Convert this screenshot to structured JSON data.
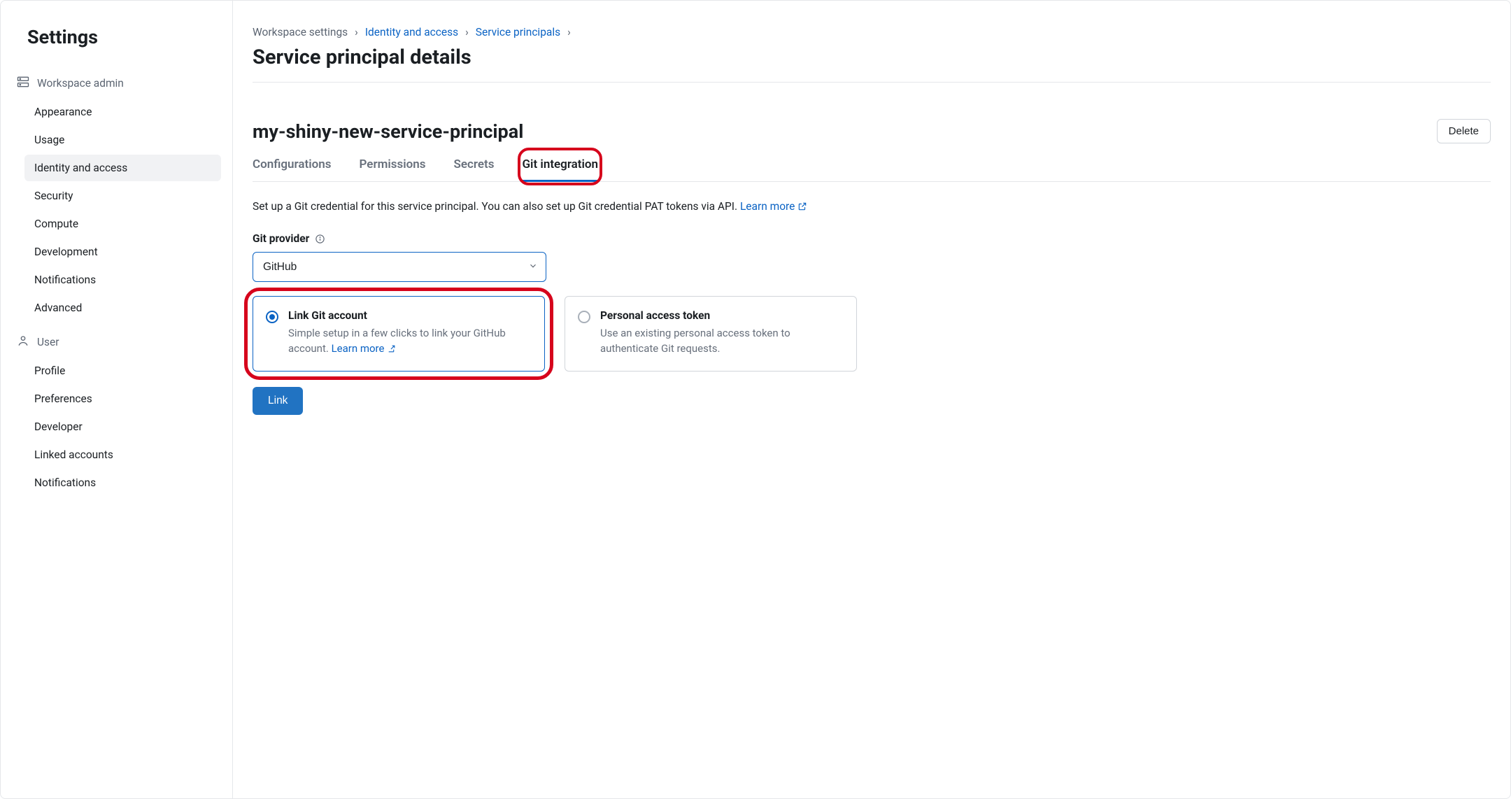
{
  "sidebar": {
    "title": "Settings",
    "sections": [
      {
        "label": "Workspace admin",
        "items": [
          "Appearance",
          "Usage",
          "Identity and access",
          "Security",
          "Compute",
          "Development",
          "Notifications",
          "Advanced"
        ]
      },
      {
        "label": "User",
        "items": [
          "Profile",
          "Preferences",
          "Developer",
          "Linked accounts",
          "Notifications"
        ]
      }
    ],
    "active_item": "Identity and access"
  },
  "breadcrumb": {
    "items": [
      "Workspace settings",
      "Identity and access",
      "Service principals"
    ]
  },
  "page": {
    "title": "Service principal details",
    "principal_name": "my-shiny-new-service-principal",
    "delete_label": "Delete"
  },
  "tabs": [
    "Configurations",
    "Permissions",
    "Secrets",
    "Git integration"
  ],
  "active_tab": "Git integration",
  "git": {
    "description": "Set up a Git credential for this service principal. You can also set up Git credential PAT tokens via API. ",
    "learn_more": "Learn more",
    "provider_label": "Git provider",
    "provider_value": "GitHub",
    "options": [
      {
        "title": "Link Git account",
        "desc_prefix": "Simple setup in a few clicks to link your GitHub account. ",
        "learn_more": "Learn more"
      },
      {
        "title": "Personal access token",
        "desc": "Use an existing personal access token to authenticate Git requests."
      }
    ],
    "link_button": "Link"
  }
}
